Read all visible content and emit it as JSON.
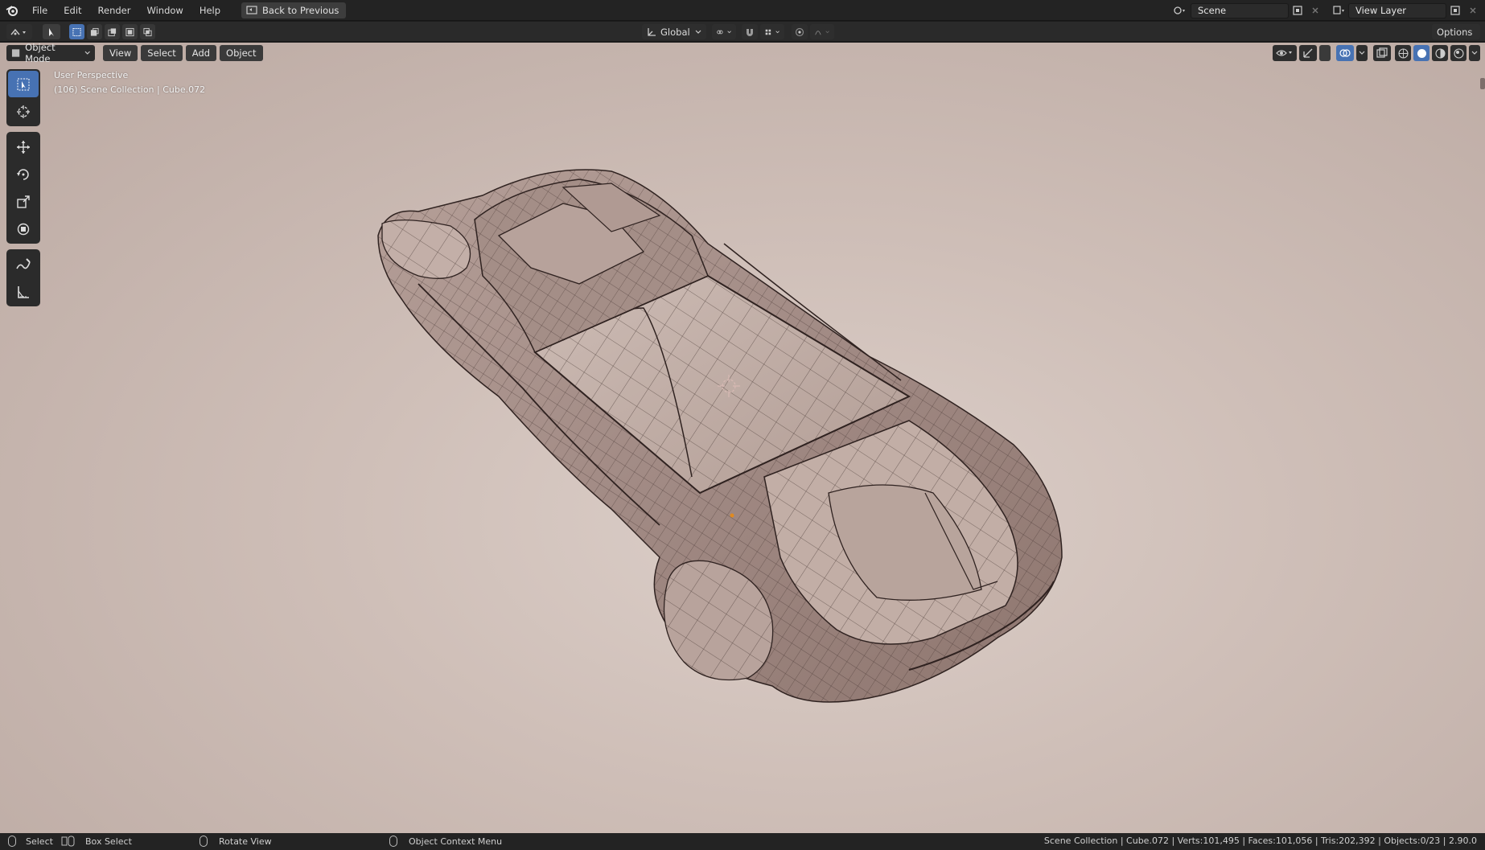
{
  "menu": {
    "items": [
      "File",
      "Edit",
      "Render",
      "Window",
      "Help"
    ],
    "back_button": "Back to Previous"
  },
  "workspace": {
    "scene_label": "Scene",
    "view_layer_label": "View Layer"
  },
  "tool_header": {
    "orientation": "Global",
    "options_label": "Options"
  },
  "viewport": {
    "mode_label": "Object Mode",
    "menus": [
      "View",
      "Select",
      "Add",
      "Object"
    ],
    "perspective_text": "User Perspective",
    "collection_text": "(106) Scene Collection | Cube.072",
    "background_color": "#cfbfb8"
  },
  "toolbar": {
    "tools": [
      "select-box-icon",
      "cursor-icon",
      "move-icon",
      "rotate-icon",
      "scale-icon",
      "transform-icon",
      "annotate-icon",
      "measure-icon"
    ],
    "active_tool": "select-box-icon"
  },
  "statusbar": {
    "select": "Select",
    "box_select": "Box Select",
    "rotate_view": "Rotate View",
    "context_menu": "Object Context Menu",
    "stats": "Scene Collection | Cube.072 | Verts:101,495 | Faces:101,056 | Tris:202,392 | Objects:0/23 | 2.90.0"
  },
  "colors": {
    "accent": "#4772b3",
    "topbar": "#232323",
    "header": "#2a2a2a"
  }
}
